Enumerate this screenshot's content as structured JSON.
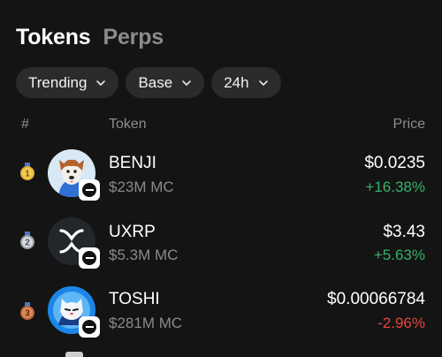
{
  "tabs": [
    {
      "label": "Tokens",
      "active": true
    },
    {
      "label": "Perps",
      "active": false
    }
  ],
  "filters": [
    {
      "label": "Trending"
    },
    {
      "label": "Base"
    },
    {
      "label": "24h"
    }
  ],
  "table": {
    "col_rank": "#",
    "col_token": "Token",
    "col_price": "Price"
  },
  "tokens": [
    {
      "rank": "1",
      "name": "BENJI",
      "market_cap": "$23M MC",
      "price": "$0.0235",
      "change": "+16.38%",
      "direction": "up",
      "medal_color": "#e2b33a",
      "avatar_icon": "dog-avatar-icon"
    },
    {
      "rank": "2",
      "name": "UXRP",
      "market_cap": "$5.3M MC",
      "price": "$3.43",
      "change": "+5.63%",
      "direction": "up",
      "medal_color": "#b8bec6",
      "avatar_icon": "xrp-logo-icon"
    },
    {
      "rank": "3",
      "name": "TOSHI",
      "market_cap": "$281M MC",
      "price": "$0.00066784",
      "change": "-2.96%",
      "direction": "down",
      "medal_color": "#c97346",
      "avatar_icon": "cat-avatar-icon"
    }
  ],
  "colors": {
    "background": "#141414",
    "positive": "#35b36a",
    "negative": "#e2473d",
    "chip_bg": "#2b2b2b"
  }
}
